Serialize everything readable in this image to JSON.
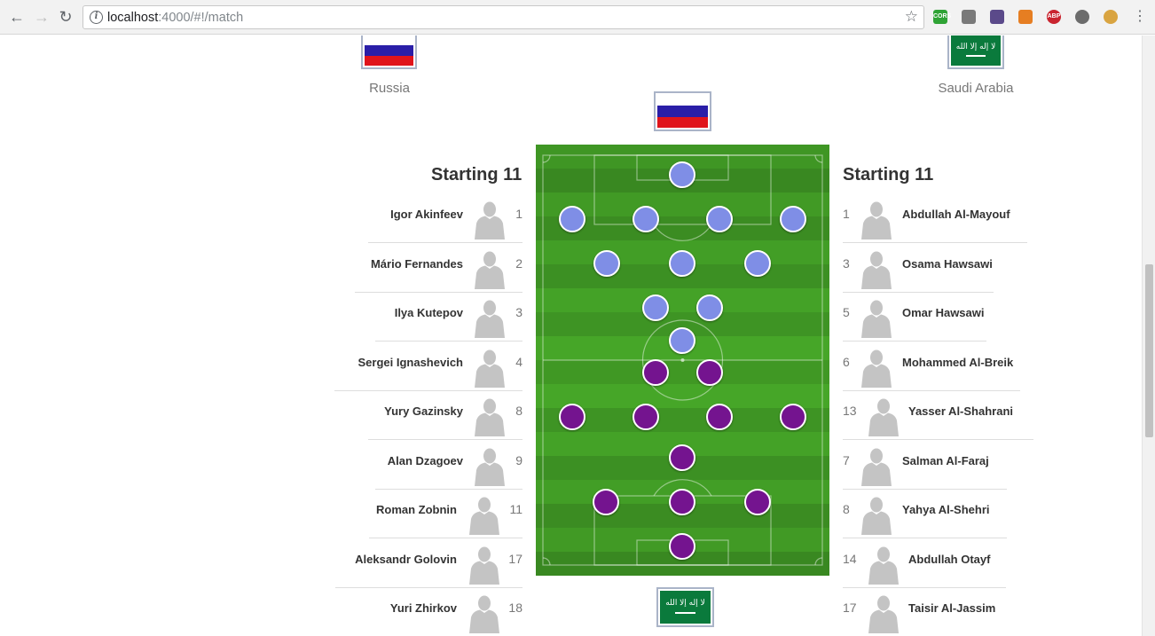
{
  "browser": {
    "url_host": "localhost",
    "url_path": ":4000/#!/match",
    "extensions": [
      {
        "name": "cors-extension-icon",
        "label": "CORS",
        "color": "#2fa335"
      },
      {
        "name": "screen-extension-icon",
        "label": "",
        "color": "#7a7a7a"
      },
      {
        "name": "eyedropper-extension-icon",
        "label": "",
        "color": "#5b4a8a"
      },
      {
        "name": "fox-extension-icon",
        "label": "",
        "color": "#e67e22"
      },
      {
        "name": "adblock-extension-icon",
        "label": "ABP",
        "color": "#c9242f"
      },
      {
        "name": "circle-extension-icon",
        "label": "",
        "color": "#6c6c6c"
      },
      {
        "name": "cookie-extension-icon",
        "label": "",
        "color": "#d9a441"
      }
    ]
  },
  "match": {
    "home": {
      "name": "Russia",
      "section_title": "Starting 11",
      "color": "#7f8ee6",
      "players": [
        {
          "name": "Igor Akinfeev",
          "number": "1"
        },
        {
          "name": "Mário Fernandes",
          "number": "2"
        },
        {
          "name": "Ilya Kutepov",
          "number": "3"
        },
        {
          "name": "Sergei Ignashevich",
          "number": "4"
        },
        {
          "name": "Yury Gazinsky",
          "number": "8"
        },
        {
          "name": "Alan Dzagoev",
          "number": "9"
        },
        {
          "name": "Roman Zobnin",
          "number": "11"
        },
        {
          "name": "Aleksandr Golovin",
          "number": "17"
        },
        {
          "name": "Yuri Zhirkov",
          "number": "18"
        }
      ]
    },
    "away": {
      "name": "Saudi Arabia",
      "section_title": "Starting 11",
      "color": "#74148f",
      "players": [
        {
          "name": "Abdullah Al-Mayouf",
          "number": "1"
        },
        {
          "name": "Osama Hawsawi",
          "number": "3"
        },
        {
          "name": "Omar Hawsawi",
          "number": "5"
        },
        {
          "name": "Mohammed Al-Breik",
          "number": "6"
        },
        {
          "name": "Yasser Al-Shahrani",
          "number": "13"
        },
        {
          "name": "Salman Al-Faraj",
          "number": "7"
        },
        {
          "name": "Yahya Al-Shehri",
          "number": "8"
        },
        {
          "name": "Abdullah Otayf",
          "number": "14"
        },
        {
          "name": "Taisir Al-Jassim",
          "number": "17"
        }
      ]
    }
  }
}
